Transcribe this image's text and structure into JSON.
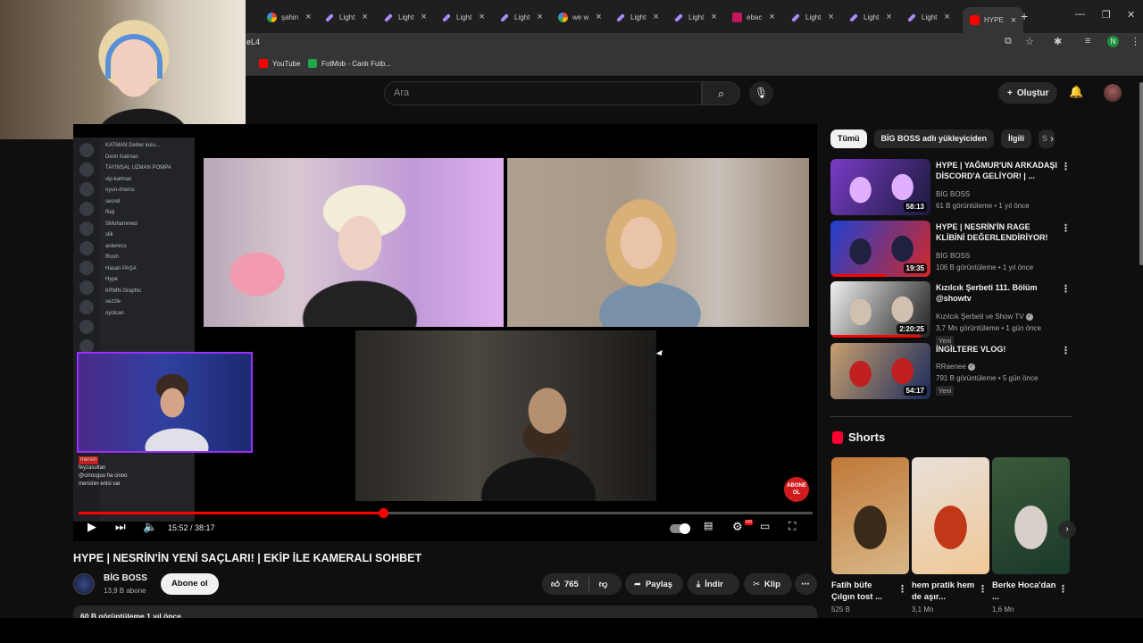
{
  "browser": {
    "tabs": [
      {
        "label": "şahin",
        "favicon": "google-icon"
      },
      {
        "label": "Light",
        "favicon": "feather-icon"
      },
      {
        "label": "Light",
        "favicon": "feather-icon"
      },
      {
        "label": "Light",
        "favicon": "feather-icon"
      },
      {
        "label": "Light",
        "favicon": "feather-icon"
      },
      {
        "label": "we w",
        "favicon": "google-icon"
      },
      {
        "label": "Light",
        "favicon": "feather-icon"
      },
      {
        "label": "Light",
        "favicon": "feather-icon"
      },
      {
        "label": "ebac",
        "favicon": "ebay-icon"
      },
      {
        "label": "Light",
        "favicon": "feather-icon"
      },
      {
        "label": "Light",
        "favicon": "feather-icon"
      },
      {
        "label": "Light",
        "favicon": "feather-icon"
      },
      {
        "label": "HYPE",
        "favicon": "youtube-icon",
        "active": true
      }
    ],
    "url_fragment": "eL4",
    "profile_initial": "N",
    "bookmarks": [
      {
        "label": "YouTube",
        "color": "#ff0000"
      },
      {
        "label": "FotMob - Canlı Futb...",
        "color": "#1fa64a"
      }
    ]
  },
  "masthead": {
    "search_placeholder": "Ara",
    "create_label": "Oluştur"
  },
  "player": {
    "current_time": "15:52 / 38:17",
    "progress_fraction": 0.4145,
    "discord_channels": [
      "KATMAN Deliler kulu...",
      "Derin Katman",
      "TAYINSAL UZMAN POMPA",
      "vip-katman",
      "oyun-önerisi",
      "secret",
      "Reji",
      "SMuhammed",
      "slik",
      "aniwrecs",
      "ffrush",
      "Hasan PAŞA",
      "Hype",
      "KRMN Graphic",
      "sezzle",
      "oyolcan"
    ],
    "chat_lines": [
      "mersin",
      "feyzasultan",
      "@cinocguu ha cinoo",
      "mersinin enisi var"
    ],
    "abone_label": "ABONE OL"
  },
  "video": {
    "title": "HYPE | NESRİN'İN YENİ SAÇLARI! | EKİP İLE KAMERALI SOHBET",
    "channel_name": "BİG BOSS",
    "channel_subs": "13,9 B abone",
    "subscribe_label": "Abone ol",
    "likes": "765",
    "share_label": "Paylaş",
    "download_label": "İndir",
    "clip_label": "Klip",
    "views_line": "60 B görüntüleme  1 yıl önce"
  },
  "sidebar": {
    "chips": [
      "Tümü",
      "BİG BOSS adlı yükleyiciden",
      "İlgili",
      "S"
    ],
    "recommendations": [
      {
        "title": "HYPE | YAĞMUR'UN ARKADAŞI DİSCORD'A GELİYOR! | ...",
        "channel": "BİG BOSS",
        "meta": "61 B görüntüleme • 1 yıl önce",
        "duration": "58:13",
        "badge": "",
        "verified": false,
        "thumb_colors": [
          "#7a3cc8",
          "#1a1a3a",
          "#e0b0ff"
        ],
        "watched_fraction": 0
      },
      {
        "title": "HYPE | NESRİN'İN RAGE KLİBİNİ DEĞERLENDİRİYOR!",
        "channel": "BİG BOSS",
        "meta": "106 B görüntüleme • 1 yıl önce",
        "duration": "19:35",
        "badge": "",
        "verified": false,
        "thumb_colors": [
          "#2040d0",
          "#d02828",
          "#202040"
        ],
        "watched_fraction": 0.55
      },
      {
        "title": "Kızılcık Şerbeti 111. Bölüm @showtv",
        "channel": "Kızılcık Şerbeti  ve Show TV",
        "meta": "3,7 Mn görüntüleme • 1 gün önce",
        "duration": "2:20:25",
        "badge": "Yeni",
        "verified": true,
        "thumb_colors": [
          "#f0f0f0",
          "#202020",
          "#d0c0b0"
        ],
        "watched_fraction": 0.9
      },
      {
        "title": "İNGİLTERE VLOG!",
        "channel": "RRaenee",
        "meta": "791 B görüntüleme • 5 gün önce",
        "duration": "54:17",
        "badge": "Yeni",
        "verified": true,
        "thumb_colors": [
          "#c8a070",
          "#1a2a5a",
          "#c02020"
        ],
        "watched_fraction": 0
      }
    ],
    "shorts_heading": "Shorts",
    "shorts": [
      {
        "title": "Fatih büfe Çılgın tost ...",
        "views": "525 B",
        "thumb_colors": [
          "#c07838",
          "#3a2a1a",
          "#d8b888"
        ]
      },
      {
        "title": "hem pratik hem de aşır...",
        "views": "3,1 Mn",
        "thumb_colors": [
          "#e8e0d8",
          "#c03818",
          "#f0c898"
        ]
      },
      {
        "title": "Berke Hoca'dan ...",
        "views": "1,6 Mn",
        "thumb_colors": [
          "#3a5a3a",
          "#d8d0c8",
          "#1a3a2a"
        ]
      }
    ]
  }
}
